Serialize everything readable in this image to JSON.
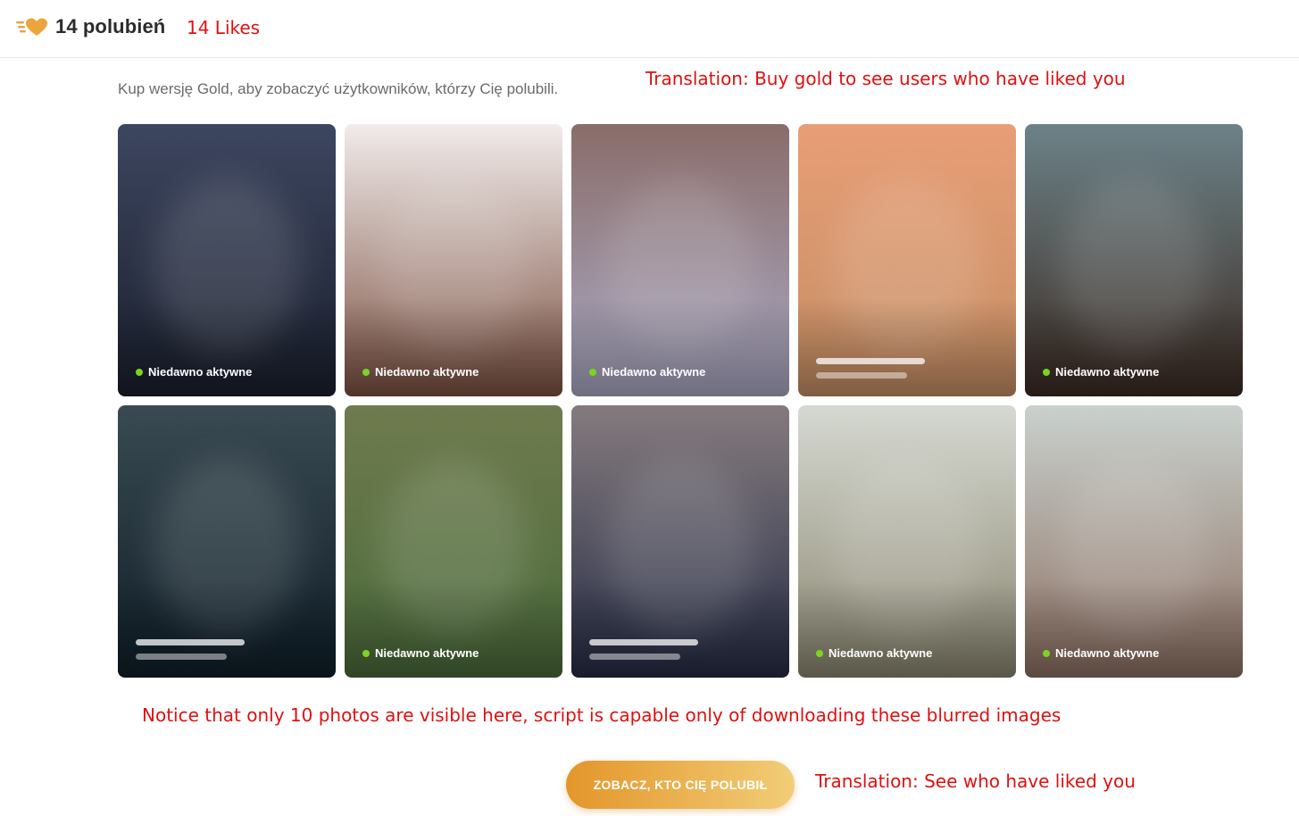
{
  "header": {
    "icon": "gold-heart-likes-icon",
    "title": "14 polubień",
    "translation_note": "14 Likes"
  },
  "main": {
    "subtitle": "Kup wersję Gold, aby zobaczyć użytkowników, którzy Cię polubili.",
    "subtitle_translation_note": "Translation: Buy gold to see users who have liked you",
    "cards": [
      {
        "status": "Niedawno aktywne",
        "placeholder": false,
        "colors": [
          "#3d4660",
          "#1a1f2d"
        ]
      },
      {
        "status": "Niedawno aktywne",
        "placeholder": false,
        "colors": [
          "#f1eceb",
          "#7c5142"
        ]
      },
      {
        "status": "Niedawno aktywne",
        "placeholder": false,
        "colors": [
          "#8a6d6a",
          "#aaa9c4"
        ]
      },
      {
        "status": "",
        "placeholder": true,
        "colors": [
          "#e89e76",
          "#c58e64"
        ]
      },
      {
        "status": "Niedawno aktywne",
        "placeholder": false,
        "colors": [
          "#6c8288",
          "#3b2a22"
        ]
      },
      {
        "status": "",
        "placeholder": true,
        "colors": [
          "#3a4a52",
          "#0f1e28"
        ]
      },
      {
        "status": "Niedawno aktywne",
        "placeholder": false,
        "colors": [
          "#6f7b4e",
          "#4a6a3a"
        ]
      },
      {
        "status": "",
        "placeholder": true,
        "colors": [
          "#857b7e",
          "#252c45"
        ]
      },
      {
        "status": "Niedawno aktywne",
        "placeholder": false,
        "colors": [
          "#d6d9d2",
          "#8a8670"
        ]
      },
      {
        "status": "Niedawno aktywne",
        "placeholder": false,
        "colors": [
          "#c9d1cd",
          "#8c6f62"
        ]
      }
    ],
    "photos_note": "Notice that only 10 photos are visible here, script is capable only of downloading these blurred images"
  },
  "cta": {
    "label": "ZOBACZ, KTO CIĘ POLUBIŁ",
    "translation_note": "Translation: See who have liked you"
  },
  "colors": {
    "gold_start": "#e3962a",
    "gold_end": "#f2cd78",
    "online_dot": "#7ed321",
    "annotation_red": "#e01010"
  }
}
